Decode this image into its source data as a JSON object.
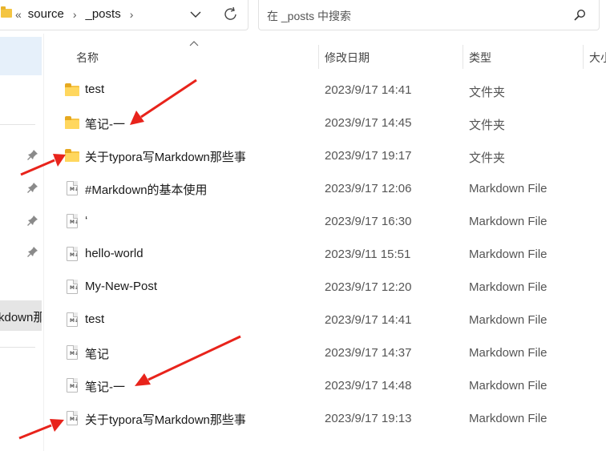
{
  "address_bar": {
    "overflow_glyph": "«",
    "crumbs": [
      "source",
      "_posts"
    ],
    "separator": "›"
  },
  "search": {
    "placeholder": "在 _posts 中搜索"
  },
  "nav": {
    "partial_item_label": "kdown那"
  },
  "columns": {
    "name": "名称",
    "date": "修改日期",
    "type": "类型",
    "size": "大小"
  },
  "files": [
    {
      "name": "test",
      "date": "2023/9/17 14:41",
      "type": "文件夹",
      "icon": "folder-icon"
    },
    {
      "name": "笔记-一",
      "date": "2023/9/17 14:45",
      "type": "文件夹",
      "icon": "folder-icon"
    },
    {
      "name": "关于typora写Markdown那些事",
      "date": "2023/9/17 19:17",
      "type": "文件夹",
      "icon": "folder-icon"
    },
    {
      "name": "#Markdown的基本使用",
      "date": "2023/9/17 12:06",
      "type": "Markdown File",
      "icon": "markdown-file-icon"
    },
    {
      "name": "‘",
      "date": "2023/9/17 16:30",
      "type": "Markdown File",
      "icon": "markdown-file-icon"
    },
    {
      "name": "hello-world",
      "date": "2023/9/11 15:51",
      "type": "Markdown File",
      "icon": "markdown-file-icon"
    },
    {
      "name": "My-New-Post",
      "date": "2023/9/17 12:20",
      "type": "Markdown File",
      "icon": "markdown-file-icon"
    },
    {
      "name": "test",
      "date": "2023/9/17 14:41",
      "type": "Markdown File",
      "icon": "markdown-file-icon"
    },
    {
      "name": "笔记",
      "date": "2023/9/17 14:37",
      "type": "Markdown File",
      "icon": "markdown-file-icon"
    },
    {
      "name": "笔记-一",
      "date": "2023/9/17 14:48",
      "type": "Markdown File",
      "icon": "markdown-file-icon"
    },
    {
      "name": "关于typora写Markdown那些事",
      "date": "2023/9/17 19:13",
      "type": "Markdown File",
      "icon": "markdown-file-icon"
    }
  ],
  "md_icon_text": "M↓",
  "colors": {
    "annotation_arrow": "#e8231b",
    "folder": "#f6c445",
    "nav_selected": "#e6f0fa"
  }
}
